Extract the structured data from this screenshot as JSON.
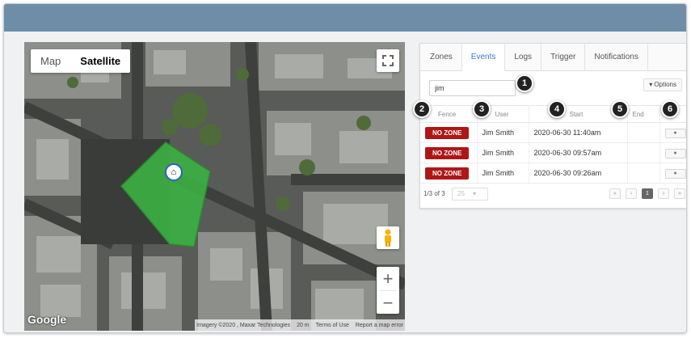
{
  "map": {
    "type_options": [
      "Map",
      "Satellite"
    ],
    "active_type": "Satellite",
    "zoom_in": "+",
    "zoom_out": "−",
    "google_label": "Google",
    "attribution": [
      "Imagery ©2020 , Maxar Technologies",
      "20 m",
      "Terms of Use",
      "Report a map error"
    ],
    "fence_color": "#3cb043"
  },
  "panel": {
    "tabs": [
      "Zones",
      "Events",
      "Logs",
      "Trigger",
      "Notifications"
    ],
    "active_tab": "Events",
    "search_value": "jim",
    "options_label": "▾ Options",
    "columns": [
      "Fence",
      "User",
      "Start",
      "End"
    ],
    "rows": [
      {
        "fence": "NO ZONE",
        "user": "Jim Smith",
        "start": "2020-06-30 11:40am",
        "end": ""
      },
      {
        "fence": "NO ZONE",
        "user": "Jim Smith",
        "start": "2020-06-30 09:57am",
        "end": ""
      },
      {
        "fence": "NO ZONE",
        "user": "Jim Smith",
        "start": "2020-06-30 09:26am",
        "end": ""
      }
    ],
    "count_label": "1/3 of 3",
    "page_size": "25",
    "current_page": "1",
    "badge_color": "#b01616"
  },
  "callouts": [
    "1",
    "2",
    "3",
    "4",
    "5",
    "6"
  ]
}
